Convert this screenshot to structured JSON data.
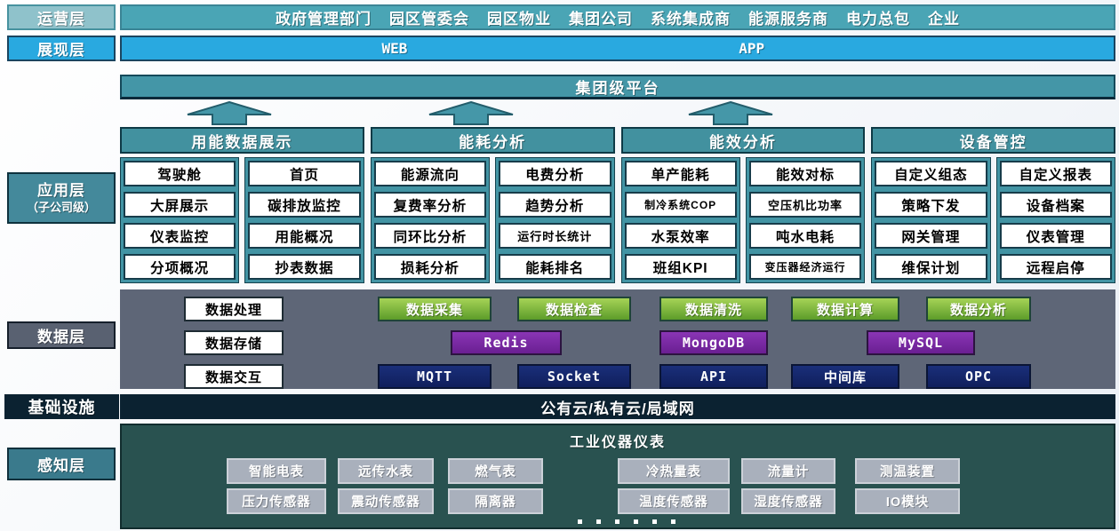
{
  "layers": {
    "operation": {
      "label": "运营层",
      "items": [
        "政府管理部门",
        "园区管委会",
        "园区物业",
        "集团公司",
        "系统集成商",
        "能源服务商",
        "电力总包",
        "企业"
      ]
    },
    "presentation": {
      "label": "展现层",
      "web": "WEB",
      "app": "APP"
    },
    "platform": {
      "title": "集团级平台"
    },
    "application": {
      "label": "应用层",
      "sublabel": "（子公司级）",
      "groups": [
        {
          "header": "用能数据展示",
          "columns": [
            [
              "驾驶舱",
              "大屏展示",
              "仪表监控",
              "分项概况"
            ],
            [
              "首页",
              "碳排放监控",
              "用能概况",
              "抄表数据"
            ]
          ]
        },
        {
          "header": "能耗分析",
          "columns": [
            [
              "能源流向",
              "复费率分析",
              "同环比分析",
              "损耗分析"
            ],
            [
              "电费分析",
              "趋势分析",
              "运行时长统计",
              "能耗排名"
            ]
          ]
        },
        {
          "header": "能效分析",
          "columns": [
            [
              "单产能耗",
              "制冷系统COP",
              "水泵效率",
              "班组KPI"
            ],
            [
              "能效对标",
              "空压机比功率",
              "吨水电耗",
              "变压器经济运行"
            ]
          ]
        },
        {
          "header": "设备管控",
          "columns": [
            [
              "自定义组态",
              "策略下发",
              "网关管理",
              "维保计划"
            ],
            [
              "自定义报表",
              "设备档案",
              "仪表管理",
              "远程启停"
            ]
          ]
        }
      ]
    },
    "data": {
      "label": "数据层",
      "white_boxes": [
        "数据处理",
        "数据存储",
        "数据交互"
      ],
      "green_boxes": [
        "数据采集",
        "数据检查",
        "数据清洗",
        "数据计算",
        "数据分析"
      ],
      "purple_boxes": [
        "Redis",
        "MongoDB",
        "MySQL"
      ],
      "blue_boxes": [
        "MQTT",
        "Socket",
        "API",
        "中间库",
        "OPC"
      ]
    },
    "infrastructure": {
      "label": "基础设施",
      "title": "公有云/私有云/局域网"
    },
    "perception": {
      "label": "感知层",
      "title": "工业仪器仪表",
      "devices_row1": [
        "智能电表",
        "远传水表",
        "燃气表",
        "冷热量表",
        "流量计",
        "测温装置"
      ],
      "devices_row2": [
        "压力传感器",
        "震动传感器",
        "隔离器",
        "温度传感器",
        "湿度传感器",
        "IO模块"
      ],
      "ellipsis_dots": 6
    }
  },
  "colors": {
    "operation_bar": "#4aa5b5",
    "presentation_bar": "#29a9e0",
    "platform_bar": "#4496a7",
    "header_teal": "#42919f",
    "data_layer_bg": "#5e6677",
    "green_box": "#7db83e",
    "purple_box": "#7b28a5",
    "navy_box": "#15286b",
    "infrastructure_bar": "#0b2231",
    "perception_bg": "#295250",
    "device_box": "#a9b0bc"
  }
}
